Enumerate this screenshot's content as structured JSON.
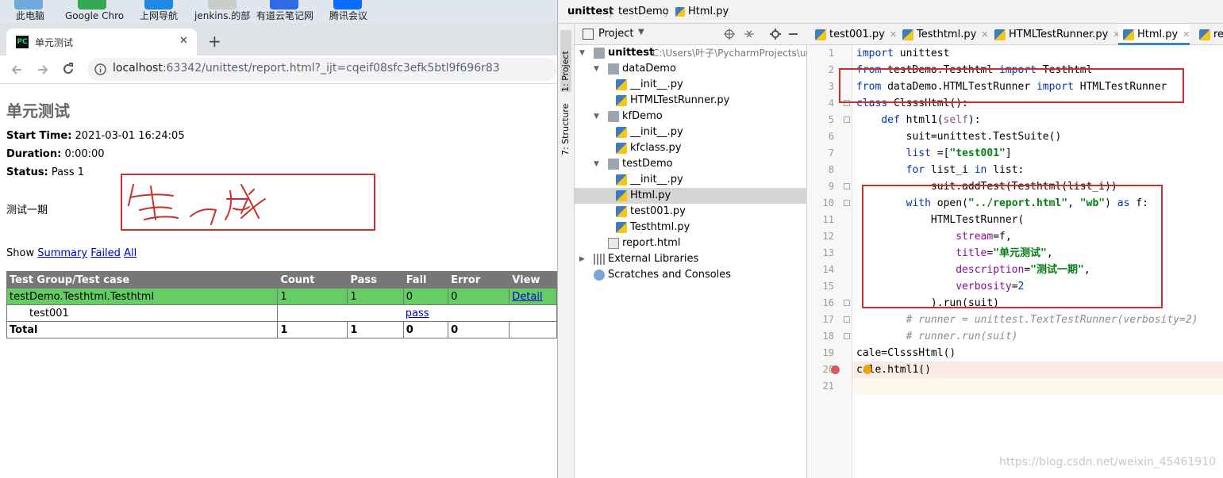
{
  "desktop": {
    "icons": [
      {
        "label": "此电脑",
        "color": "#6fa8dc"
      },
      {
        "label": "Google Chro",
        "color": "#34a853"
      },
      {
        "label": "上网导航",
        "color": "#1e88e5"
      },
      {
        "label": "jenkins.的部",
        "color": "#cccccc"
      },
      {
        "label": "有道云笔记网",
        "color": "#2d6be4"
      },
      {
        "label": "腾讯会议",
        "color": "#0a6cff"
      }
    ]
  },
  "browser": {
    "tab_title": "单元测试",
    "new_tab": "+",
    "close_tab": "✕",
    "url_host": "localhost",
    "url_rest": ":63342/unittest/report.html?_ijt=cqeif08sfc3efk5btl9f696r83"
  },
  "report": {
    "heading": "单元测试",
    "start_time_label": "Start Time:",
    "start_time_value": "2021-03-01 16:24:05",
    "duration_label": "Duration:",
    "duration_value": "0:00:00",
    "status_label": "Status:",
    "status_value": "Pass 1",
    "description": "测试一期",
    "annotation_text": "生成",
    "show_label": "Show",
    "show_summary": "Summary",
    "show_failed": "Failed",
    "show_all": "All",
    "table": {
      "headers": [
        "Test Group/Test case",
        "Count",
        "Pass",
        "Fail",
        "Error",
        "View"
      ],
      "group_row": [
        "testDemo.Testhtml.Testhtml",
        "1",
        "1",
        "0",
        "0",
        "Detail"
      ],
      "case_row": {
        "name": "test001",
        "result": "pass"
      },
      "total_row": [
        "Total",
        "1",
        "1",
        "0",
        "0",
        ""
      ]
    }
  },
  "ide": {
    "breadcrumb": [
      "unittest",
      "testDemo",
      "Html.py"
    ],
    "side_tabs": [
      "1: Project",
      "7: Structure"
    ],
    "project_panel": {
      "title": "Project",
      "tree": [
        {
          "label": "unittest",
          "extra": "C:\\Users\\叶子\\PycharmProjects\\un",
          "kind": "folder",
          "depth": 0,
          "open": true
        },
        {
          "label": "dataDemo",
          "kind": "folder",
          "depth": 1,
          "open": true
        },
        {
          "label": "__init__.py",
          "kind": "py",
          "depth": 2
        },
        {
          "label": "HTMLTestRunner.py",
          "kind": "py",
          "depth": 2
        },
        {
          "label": "kfDemo",
          "kind": "folder",
          "depth": 1,
          "open": true
        },
        {
          "label": "__init__.py",
          "kind": "py",
          "depth": 2
        },
        {
          "label": "kfclass.py",
          "kind": "py",
          "depth": 2
        },
        {
          "label": "testDemo",
          "kind": "folder",
          "depth": 1,
          "open": true
        },
        {
          "label": "__init__.py",
          "kind": "py",
          "depth": 2
        },
        {
          "label": "Html.py",
          "kind": "py",
          "depth": 2,
          "selected": true
        },
        {
          "label": "test001.py",
          "kind": "py",
          "depth": 2
        },
        {
          "label": "Testhtml.py",
          "kind": "py",
          "depth": 2
        },
        {
          "label": "report.html",
          "kind": "html",
          "depth": 1
        },
        {
          "label": "External Libraries",
          "kind": "lib",
          "depth": 0,
          "open": false
        },
        {
          "label": "Scratches and Consoles",
          "kind": "scratch",
          "depth": 0
        }
      ]
    },
    "editor_tabs": [
      "test001.py",
      "Testhtml.py",
      "HTMLTestRunner.py",
      "Html.py",
      "re"
    ],
    "active_tab": "Html.py",
    "watermark": "https://blog.csdn.net/weixin_45461910"
  }
}
